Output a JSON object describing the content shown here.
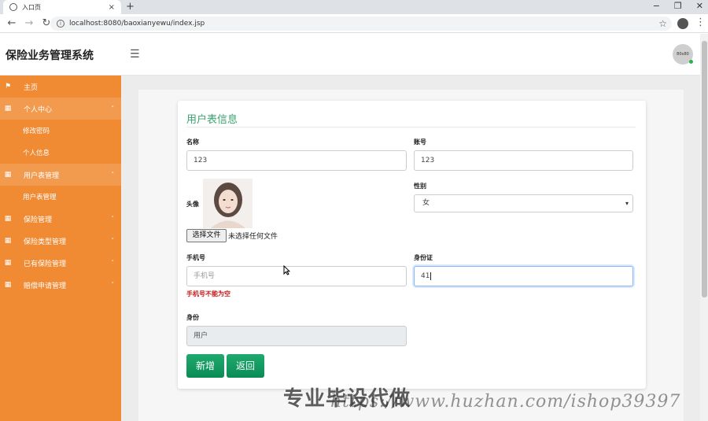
{
  "browser": {
    "tab_title": "入口页",
    "tab_close": "×",
    "new_tab": "+",
    "url": "localhost:8080/baoxianyewu/index.jsp",
    "win_minimize": "−",
    "win_restore": "❐",
    "win_close": "✕"
  },
  "header": {
    "brand": "保险业务管理系统",
    "avatar_text": "80x80"
  },
  "sidebar": {
    "items": [
      {
        "label": "主页",
        "icon": "flag-icon"
      },
      {
        "label": "个人中心",
        "icon": "grid-icon",
        "chevron": "˄"
      },
      {
        "label": "修改密码"
      },
      {
        "label": "个人信息"
      },
      {
        "label": "用户表管理",
        "icon": "grid-icon",
        "chevron": "˄"
      },
      {
        "label": "用户表管理"
      },
      {
        "label": "保险管理",
        "icon": "grid-icon",
        "chevron": "˅"
      },
      {
        "label": "保险类型管理",
        "icon": "grid-icon",
        "chevron": "˅"
      },
      {
        "label": "已有保险管理",
        "icon": "grid-icon",
        "chevron": "˅"
      },
      {
        "label": "赔偿申请管理",
        "icon": "grid-icon",
        "chevron": "˅"
      }
    ]
  },
  "form": {
    "title": "用户表信息",
    "name_label": "名称",
    "name_value": "123",
    "account_label": "账号",
    "account_value": "123",
    "avatar_label": "头像",
    "gender_label": "性别",
    "gender_value": "女",
    "file_button": "选择文件",
    "file_status": "未选择任何文件",
    "phone_label": "手机号",
    "phone_placeholder": "手机号",
    "phone_error": "手机号不能为空",
    "id_label": "身份证",
    "id_value": "41",
    "role_label": "身份",
    "role_value": "用户",
    "add_button": "新增",
    "back_button": "返回"
  },
  "watermark": {
    "cn": "专业毕设代做",
    "url": "https://www.huzhan.com/ishop39397"
  }
}
